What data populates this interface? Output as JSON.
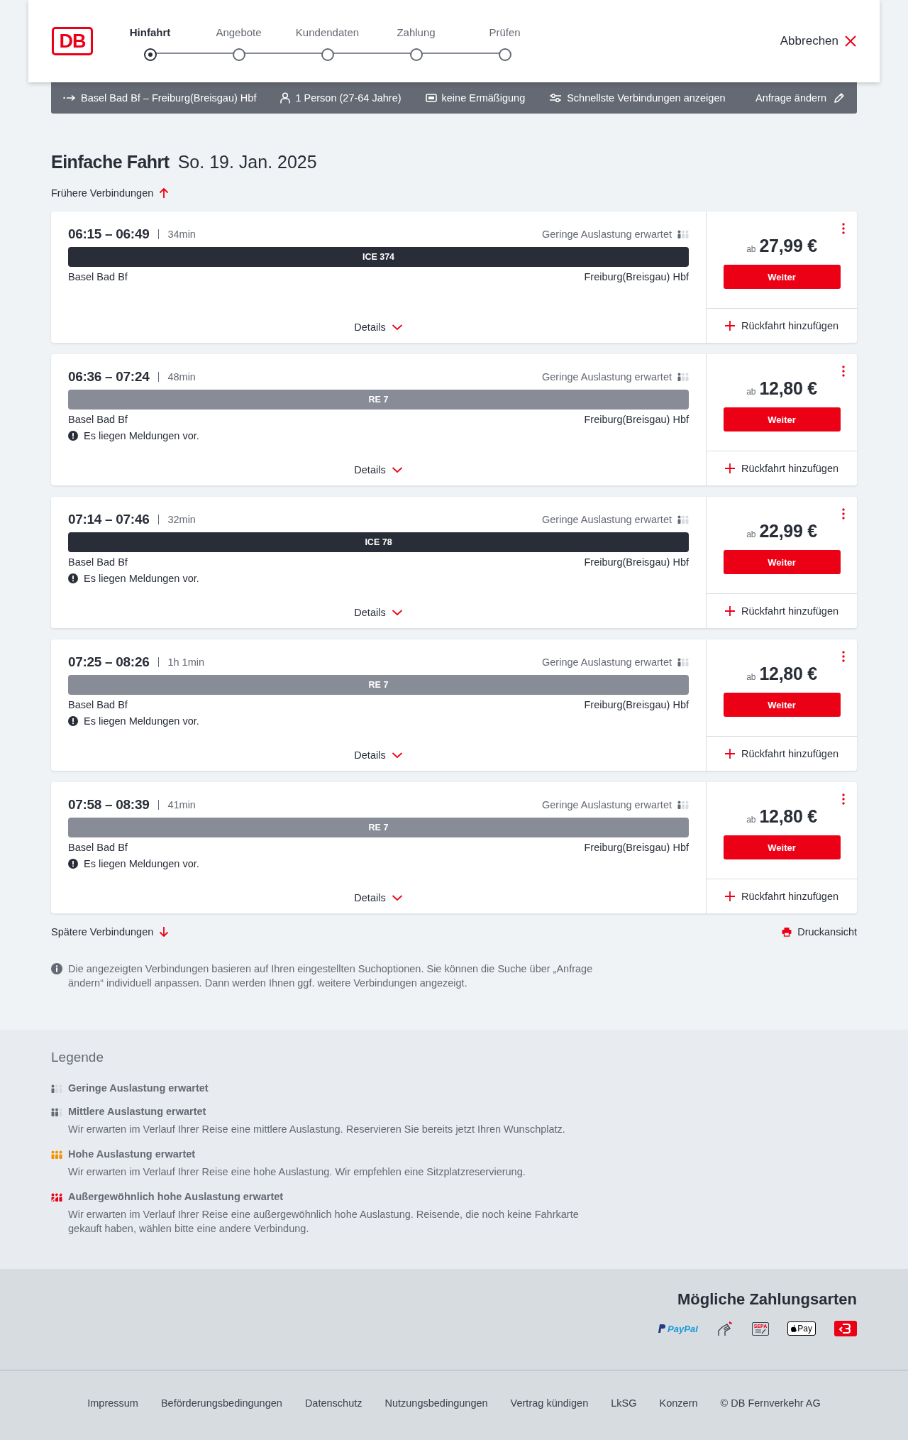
{
  "header": {
    "logo": "DB",
    "steps": [
      {
        "label": "Hinfahrt",
        "selected": true
      },
      {
        "label": "Angebote",
        "selected": false
      },
      {
        "label": "Kundendaten",
        "selected": false
      },
      {
        "label": "Zahlung",
        "selected": false
      },
      {
        "label": "Prüfen",
        "selected": false
      }
    ],
    "cancel": "Abbrechen"
  },
  "summary": {
    "route": "Basel Bad Bf – Freiburg(Breisgau) Hbf",
    "passengers": "1 Person (27-64 Jahre)",
    "discount": "keine Ermäßigung",
    "option": "Schnellste Verbindungen anzeigen",
    "edit": "Anfrage ändern"
  },
  "trip": {
    "type": "Einfache Fahrt",
    "date": "So. 19. Jan. 2025"
  },
  "earlier": "Frühere Verbindungen",
  "connections": [
    {
      "times": "06:15 – 06:49",
      "duration": "34min",
      "occupancy": {
        "text": "Geringe Auslastung erwartet",
        "kind": "low"
      },
      "train": {
        "label": "ICE 374",
        "kind": "long_distance"
      },
      "from": "Basel Bad Bf",
      "to": "Freiburg(Breisgau) Hbf",
      "details": "Details",
      "price_prefix": "ab",
      "price": "27,99 €",
      "button": "Weiter",
      "return": "Rückfahrt hinzufügen"
    },
    {
      "times": "06:36 – 07:24",
      "duration": "48min",
      "occupancy": {
        "text": "Geringe Auslastung erwartet",
        "kind": "low"
      },
      "train": {
        "label": "RE 7",
        "kind": "regional"
      },
      "from": "Basel Bad Bf",
      "to": "Freiburg(Breisgau) Hbf",
      "notice": "Es liegen Meldungen vor.",
      "details": "Details",
      "price_prefix": "ab",
      "price": "12,80 €",
      "button": "Weiter",
      "return": "Rückfahrt hinzufügen"
    },
    {
      "times": "07:14 – 07:46",
      "duration": "32min",
      "occupancy": {
        "text": "Geringe Auslastung erwartet",
        "kind": "low"
      },
      "train": {
        "label": "ICE 78",
        "kind": "long_distance"
      },
      "from": "Basel Bad Bf",
      "to": "Freiburg(Breisgau) Hbf",
      "notice": "Es liegen Meldungen vor.",
      "details": "Details",
      "price_prefix": "ab",
      "price": "22,99 €",
      "button": "Weiter",
      "return": "Rückfahrt hinzufügen"
    },
    {
      "times": "07:25 – 08:26",
      "duration": "1h 1min",
      "occupancy": {
        "text": "Geringe Auslastung erwartet",
        "kind": "low"
      },
      "train": {
        "label": "RE 7",
        "kind": "regional"
      },
      "from": "Basel Bad Bf",
      "to": "Freiburg(Breisgau) Hbf",
      "notice": "Es liegen Meldungen vor.",
      "details": "Details",
      "price_prefix": "ab",
      "price": "12,80 €",
      "button": "Weiter",
      "return": "Rückfahrt hinzufügen"
    },
    {
      "times": "07:58 – 08:39",
      "duration": "41min",
      "occupancy": {
        "text": "Geringe Auslastung erwartet",
        "kind": "low"
      },
      "train": {
        "label": "RE 7",
        "kind": "regional"
      },
      "from": "Basel Bad Bf",
      "to": "Freiburg(Breisgau) Hbf",
      "notice": "Es liegen Meldungen vor.",
      "details": "Details",
      "price_prefix": "ab",
      "price": "12,80 €",
      "button": "Weiter",
      "return": "Rückfahrt hinzufügen"
    }
  ],
  "later": "Spätere Verbindungen",
  "print": "Druckansicht",
  "info": "Die angezeigten Verbindungen basieren auf Ihren eingestellten Suchoptionen. Sie können die Suche über „Anfrage ändern“ individuell anpassen. Dann werden Ihnen ggf. weitere Verbindungen angezeigt.",
  "legend": {
    "title": "Legende",
    "items": [
      {
        "kind": "low",
        "title": "Geringe Auslastung erwartet"
      },
      {
        "kind": "medium",
        "title": "Mittlere Auslastung erwartet",
        "text": "Wir erwarten im Verlauf Ihrer Reise eine mittlere Auslastung. Reservieren Sie bereits jetzt Ihren Wunschplatz."
      },
      {
        "kind": "high",
        "title": "Hohe Auslastung erwartet",
        "text": "Wir erwarten im Verlauf Ihrer Reise eine hohe Auslastung. Wir empfehlen eine Sitzplatzreservierung."
      },
      {
        "kind": "very_high",
        "title": "Außergewöhnlich hohe Auslastung erwartet",
        "text": "Wir erwarten im Verlauf Ihrer Reise eine außergewöhnlich hohe Auslastung. Reisende, die noch keine Fahrkarte gekauft haben, wählen bitte eine andere Verbindung."
      }
    ]
  },
  "payment": {
    "title": "Mögliche Zahlungsarten",
    "methods": [
      {
        "kind": "paypal",
        "label": "PayPal"
      },
      {
        "kind": "card"
      },
      {
        "kind": "sepa",
        "label": "SEPA"
      },
      {
        "kind": "applepay",
        "label": "Pay"
      },
      {
        "kind": "bonus"
      }
    ]
  },
  "footer_links": [
    "Impressum",
    "Beförderungsbedingungen",
    "Datenschutz",
    "Nutzungsbedingungen",
    "Vertrag kündigen",
    "LkSG",
    "Konzern",
    "© DB Fernverkehr AG"
  ]
}
